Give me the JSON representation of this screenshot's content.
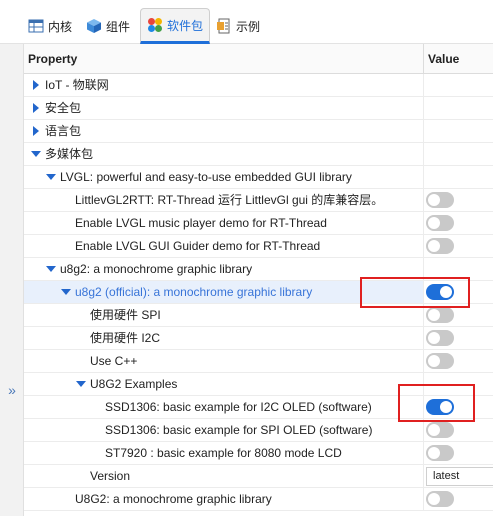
{
  "tabs": [
    {
      "label": "内核",
      "icon": "grid-icon",
      "active": false
    },
    {
      "label": "组件",
      "icon": "cube-icon",
      "active": false
    },
    {
      "label": "软件包",
      "icon": "packages-icon",
      "active": true
    },
    {
      "label": "示例",
      "icon": "examples-icon",
      "active": false
    }
  ],
  "grid": {
    "header_property": "Property",
    "header_value": "Value"
  },
  "rows": [
    {
      "label": "IoT - 物联网",
      "arrow": "right",
      "indent": 0,
      "value": null
    },
    {
      "label": "安全包",
      "arrow": "right",
      "indent": 0,
      "value": null
    },
    {
      "label": "语言包",
      "arrow": "right",
      "indent": 0,
      "value": null
    },
    {
      "label": "多媒体包",
      "arrow": "down",
      "indent": 0,
      "value": null
    },
    {
      "label": "LVGL: powerful and easy-to-use embedded GUI library",
      "arrow": "down",
      "indent": 1,
      "value": null
    },
    {
      "label": "LittlevGL2RTT: RT-Thread 运行 LittlevGl gui 的库兼容层。",
      "arrow": null,
      "indent": 2,
      "value": "off"
    },
    {
      "label": "Enable LVGL music player demo for RT-Thread",
      "arrow": null,
      "indent": 2,
      "value": "off"
    },
    {
      "label": "Enable LVGL GUI Guider demo for RT-Thread",
      "arrow": null,
      "indent": 2,
      "value": "off"
    },
    {
      "label": "u8g2: a monochrome graphic library",
      "arrow": "down",
      "indent": 1,
      "value": null
    },
    {
      "label": "u8g2 (official): a monochrome graphic library",
      "arrow": "down",
      "indent": 2,
      "value": "on",
      "selected": true
    },
    {
      "label": "使用硬件 SPI",
      "arrow": null,
      "indent": 3,
      "value": "off"
    },
    {
      "label": "使用硬件 I2C",
      "arrow": null,
      "indent": 3,
      "value": "off"
    },
    {
      "label": "Use C++",
      "arrow": null,
      "indent": 3,
      "value": "off"
    },
    {
      "label": "U8G2 Examples",
      "arrow": "down",
      "indent": 3,
      "value": null
    },
    {
      "label": "SSD1306: basic example for I2C OLED (software)",
      "arrow": null,
      "indent": 4,
      "value": "on"
    },
    {
      "label": "SSD1306: basic example for SPI OLED (software)",
      "arrow": null,
      "indent": 4,
      "value": "off"
    },
    {
      "label": "ST7920 : basic example for 8080 mode LCD",
      "arrow": null,
      "indent": 4,
      "value": "off"
    },
    {
      "label": "Version",
      "arrow": null,
      "indent": 3,
      "value": "select",
      "select_value": "latest"
    },
    {
      "label": "U8G2: a monochrome graphic library",
      "arrow": null,
      "indent": 2,
      "value": "off"
    }
  ],
  "colors": {
    "accent": "#1e6fd9",
    "highlight_box": "#e02020",
    "toggle_off": "#c9c9c9"
  }
}
